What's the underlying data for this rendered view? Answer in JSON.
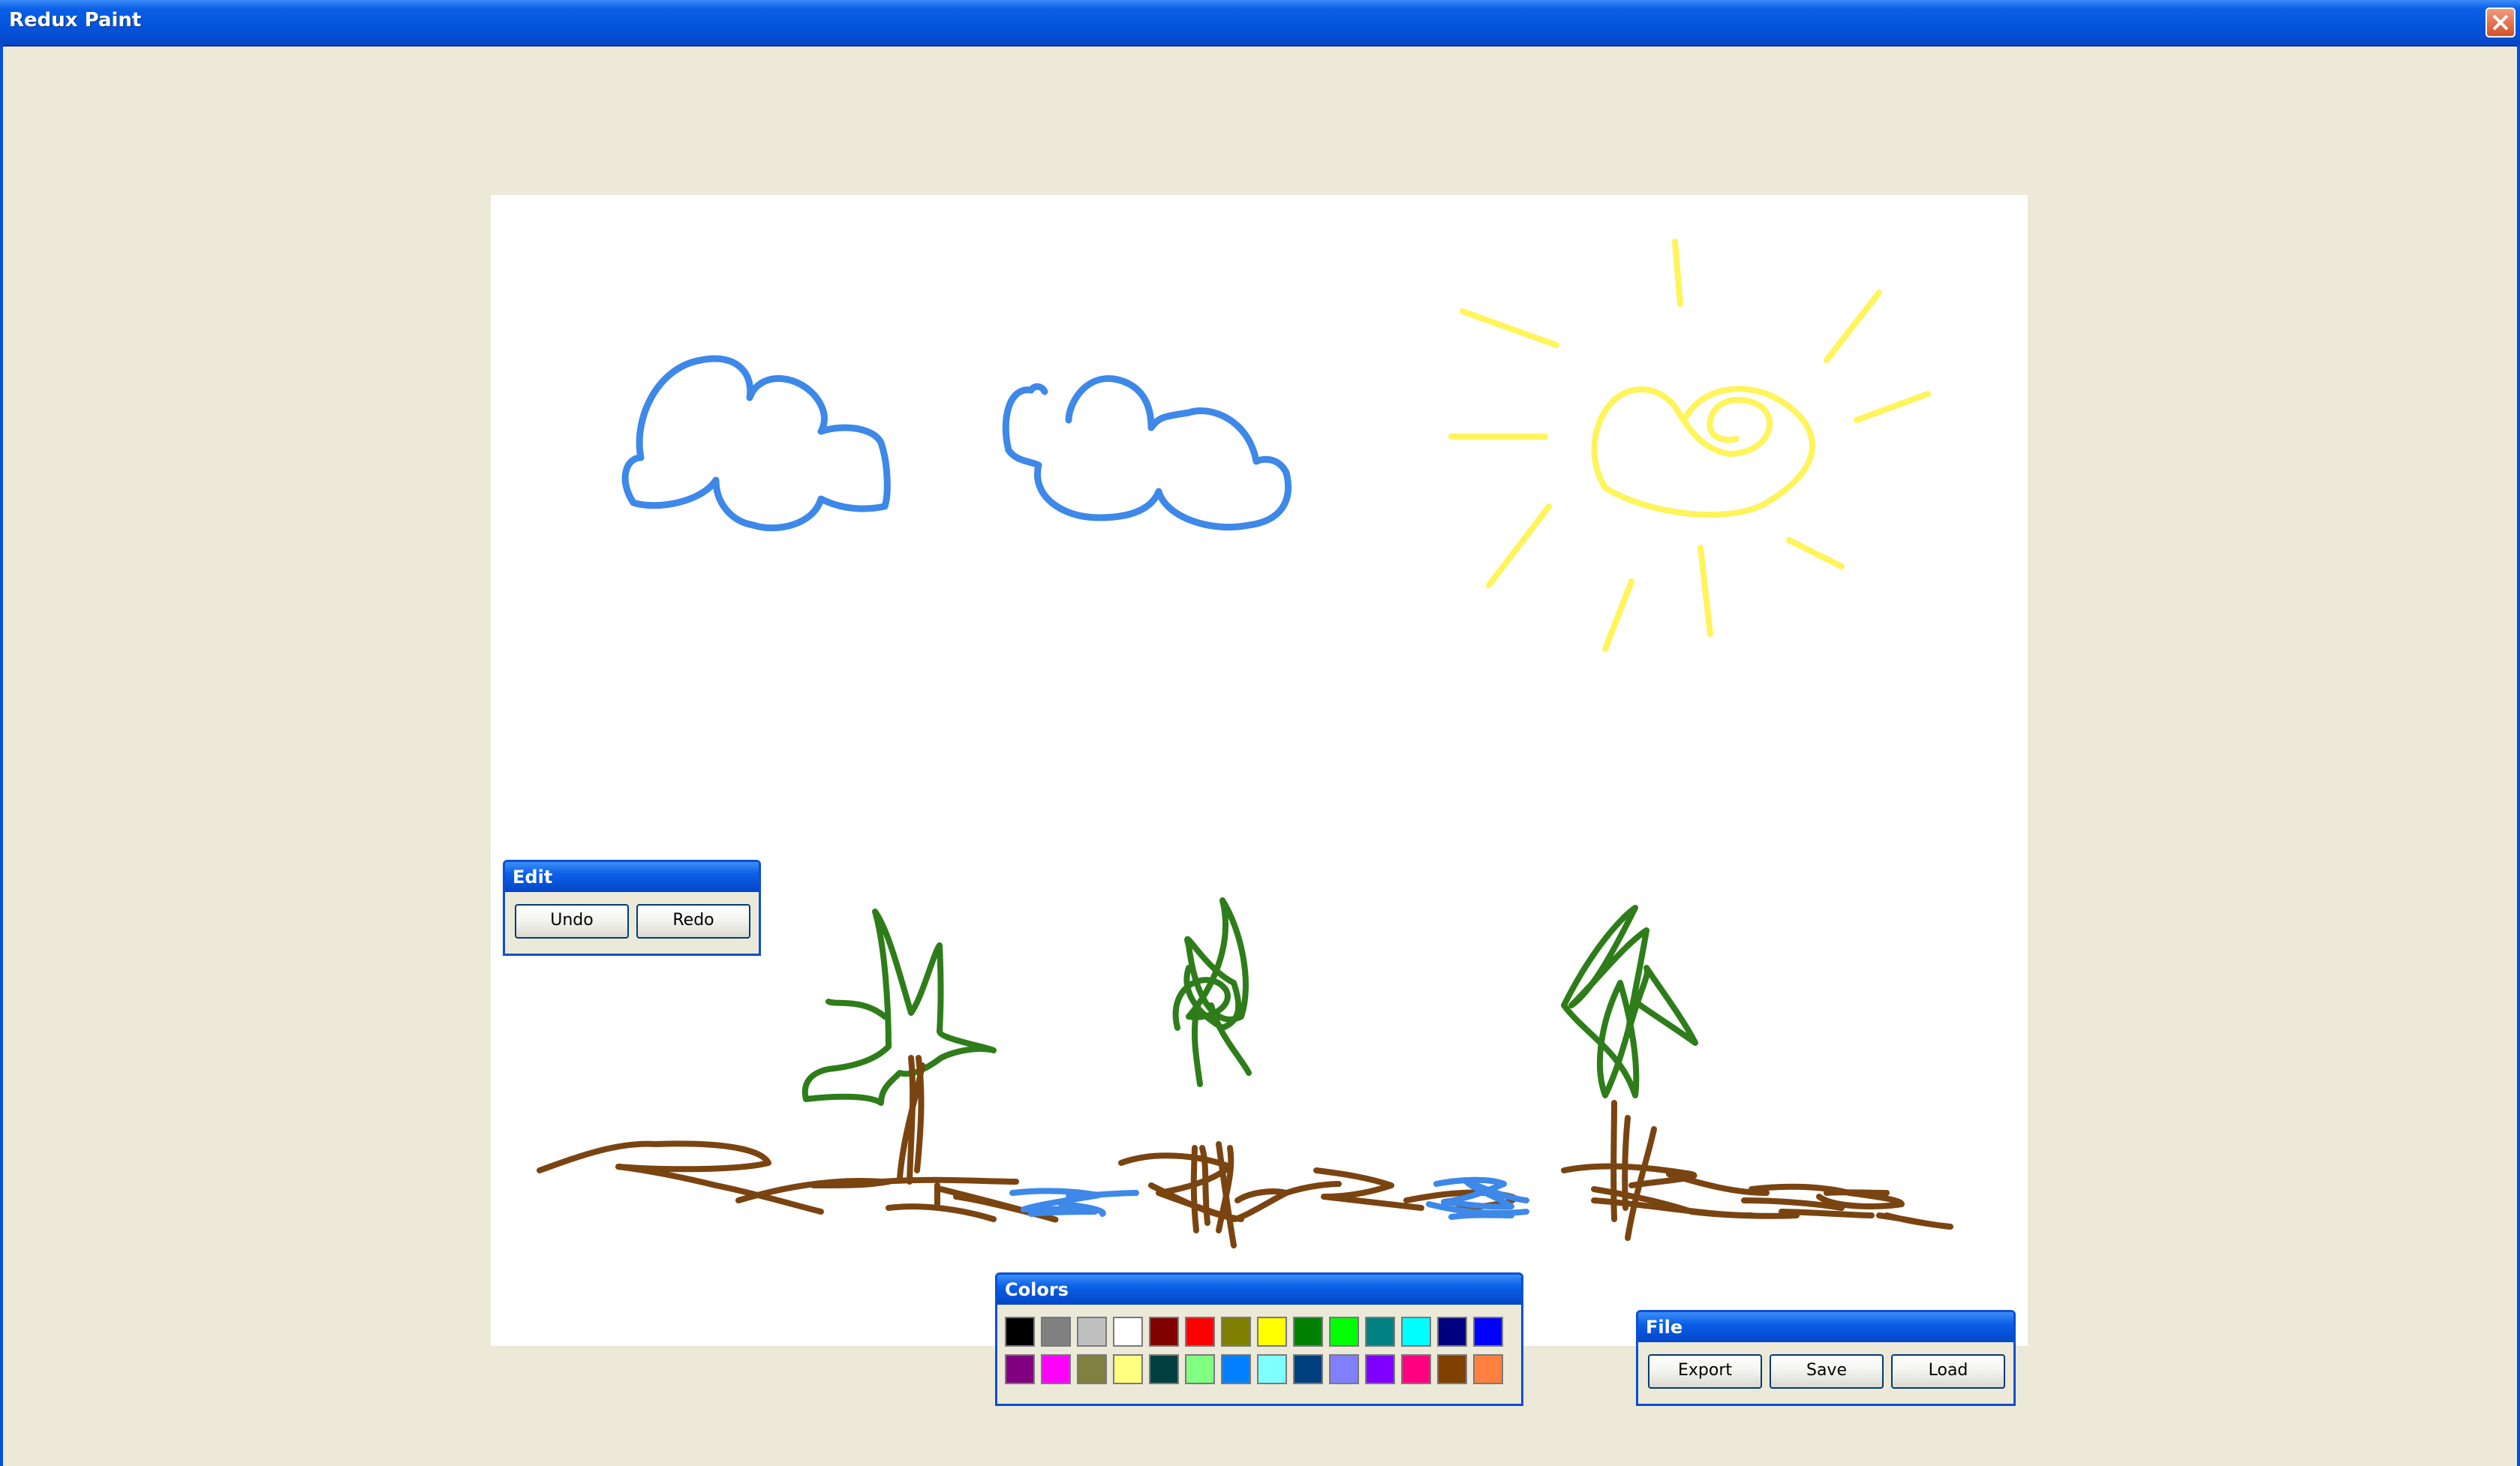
{
  "window": {
    "title": "Redux Paint"
  },
  "edit_panel": {
    "title": "Edit",
    "undo_label": "Undo",
    "redo_label": "Redo"
  },
  "colors_panel": {
    "title": "Colors",
    "row1": [
      "#000000",
      "#808080",
      "#C0C0C0",
      "#FFFFFF",
      "#800000",
      "#FF0000",
      "#808000",
      "#FFFF00",
      "#008000",
      "#00FF00",
      "#008080",
      "#00FFFF",
      "#000080",
      "#0000FF"
    ],
    "row2": [
      "#800080",
      "#FF00FF",
      "#808040",
      "#FFFF80",
      "#004040",
      "#80FF80",
      "#0080FF",
      "#80FFFF",
      "#004080",
      "#8080FF",
      "#8000FF",
      "#FF0080",
      "#804000",
      "#FF8040"
    ]
  },
  "file_panel": {
    "title": "File",
    "export_label": "Export",
    "save_label": "Save",
    "load_label": "Load"
  },
  "drawing": {
    "stroke_colors": {
      "cloud": "#3D88E8",
      "sun": "#FFF45A",
      "leaf": "#2E7D1A",
      "trunk": "#7A4411",
      "water": "#3D88E8"
    }
  }
}
